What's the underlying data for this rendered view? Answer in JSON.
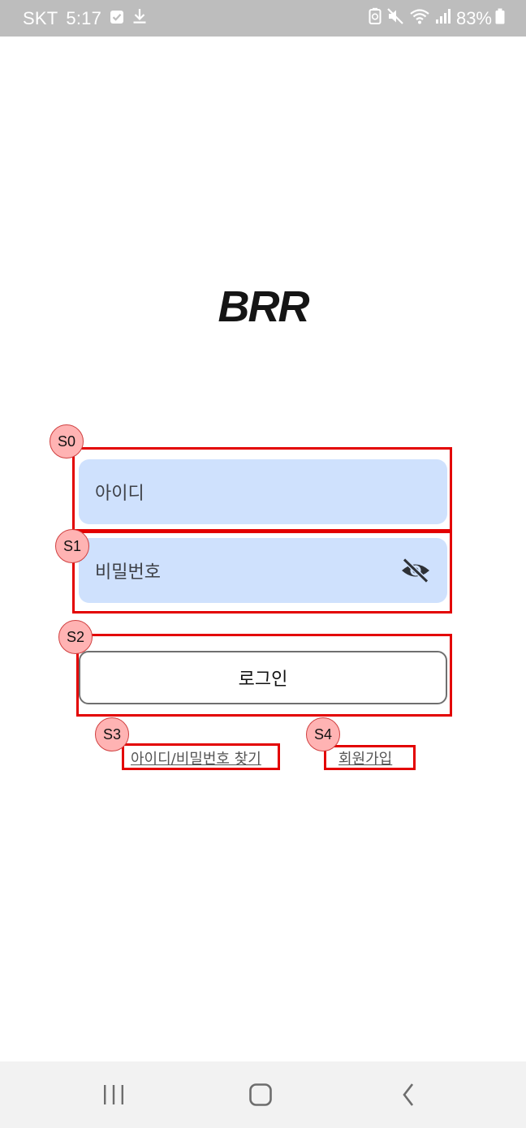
{
  "status_bar": {
    "carrier": "SKT",
    "time": "5:17",
    "battery": "83%",
    "icons": [
      "checkbox-icon",
      "download-icon",
      "battery-saver-icon",
      "mute-icon",
      "wifi-icon",
      "signal-icon",
      "battery-icon"
    ]
  },
  "app": {
    "logo": "BRR"
  },
  "login_form": {
    "id_placeholder": "아이디",
    "password_placeholder": "비밀번호",
    "password_toggle_icon": "eye-off-icon",
    "login_label": "로그인",
    "find_link": "아이디/비밀번호 찾기",
    "signup_link": "회원가입"
  },
  "annotations": [
    "S0",
    "S1",
    "S2",
    "S3",
    "S4"
  ],
  "nav_bar": {
    "icons": [
      "recent-apps-icon",
      "home-icon",
      "back-icon"
    ]
  },
  "colors": {
    "status_bar_bg": "#bdbdbd",
    "field_bg": "#cfe1fd",
    "annotation_red": "#e30000",
    "annotation_badge": "#ffb3b3",
    "nav_bar_bg": "#f2f2f2"
  }
}
